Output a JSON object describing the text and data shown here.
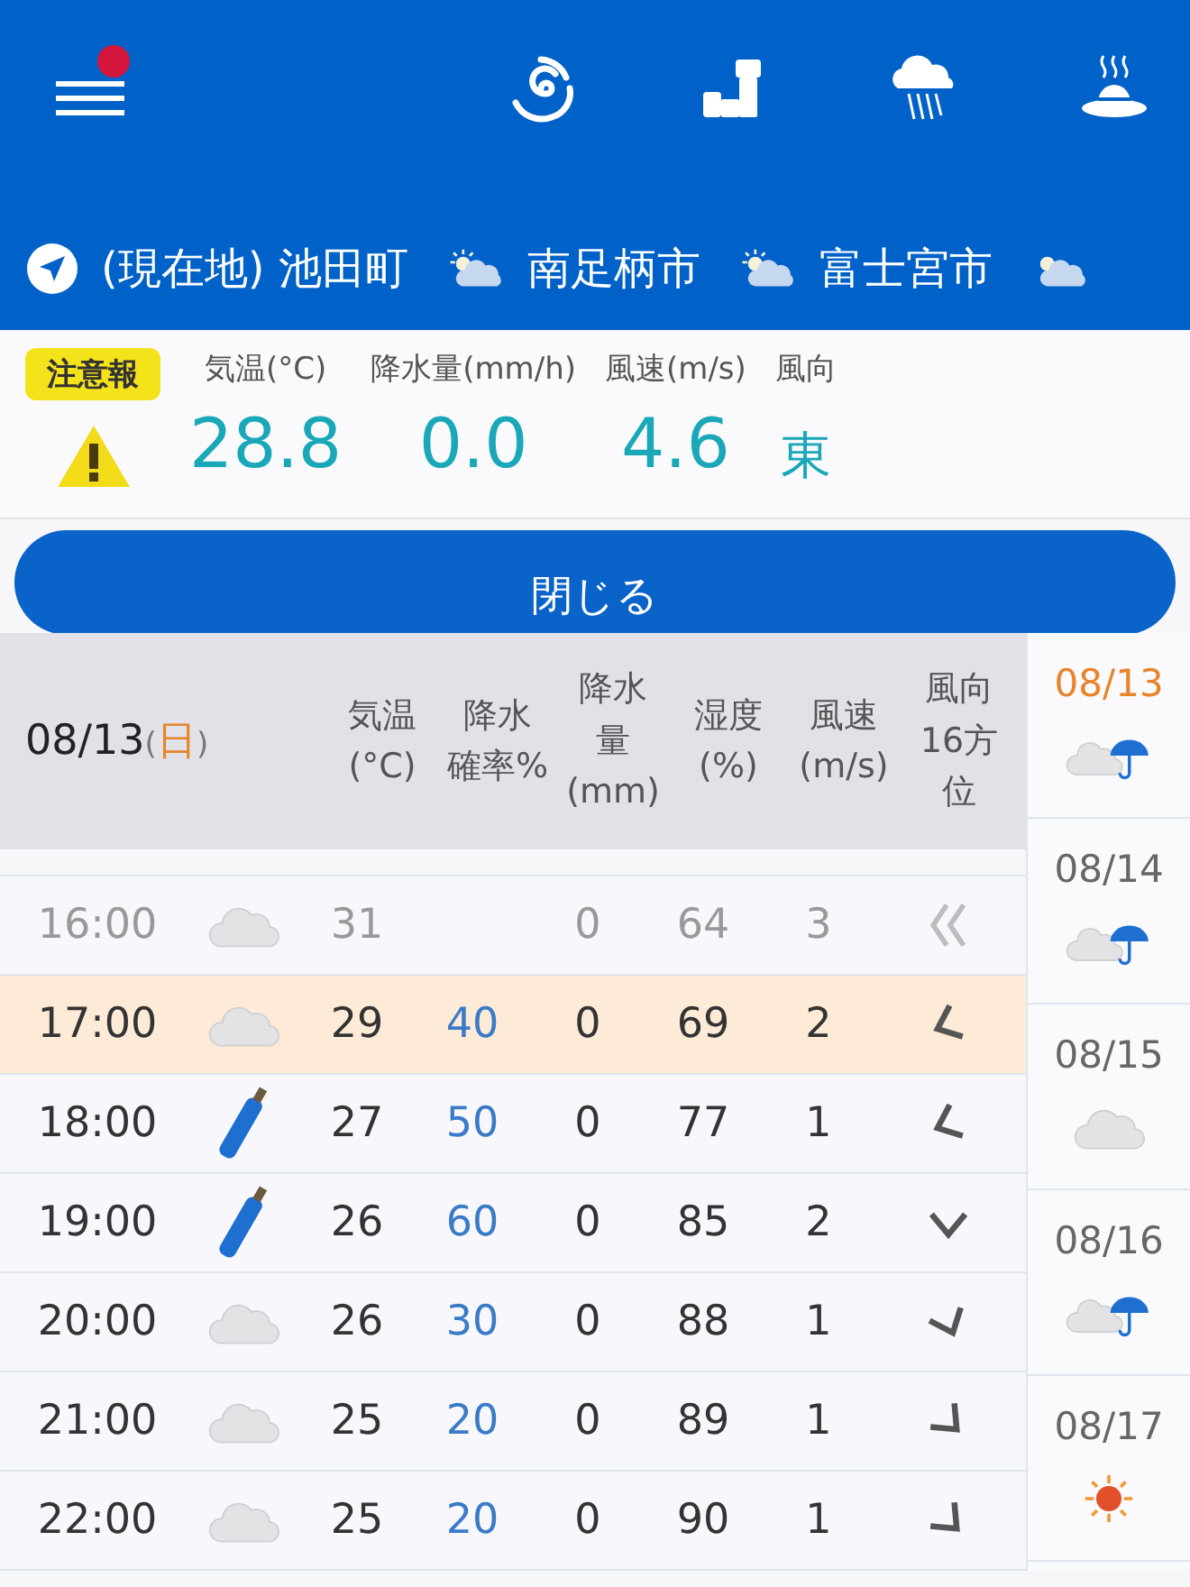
{
  "top_bar": {
    "menu_notification": true
  },
  "locations": [
    {
      "name": "(現在地) 池田町",
      "kind": "current"
    },
    {
      "name": "南足柄市",
      "kind": "weather"
    },
    {
      "name": "富士宮市",
      "kind": "weather"
    }
  ],
  "alert": {
    "badge": "注意報",
    "labels": [
      "気温(°C)",
      "降水量(mm/h)",
      "風速(m/s)",
      "風向"
    ],
    "values": [
      "28.8",
      "0.0",
      "4.6",
      "東"
    ]
  },
  "close_button": "閉じる",
  "table": {
    "date": "08/13",
    "weekday": "日",
    "brackets": [
      "(",
      ")"
    ],
    "columns": [
      [
        "気温",
        "(°C)"
      ],
      [
        "降水",
        "確率%"
      ],
      [
        "降水",
        "量",
        "(mm)"
      ],
      [
        "湿度",
        "(%)"
      ],
      [
        "風速",
        "(m/s)"
      ],
      [
        "風向",
        "16方",
        "位"
      ]
    ],
    "rows": [
      {
        "time": "16:00",
        "weather": {
          "kind": "cloudy"
        },
        "temp": "31",
        "precip": "0",
        "humidity": "64",
        "wind": "3",
        "wind_arrow": {
          "kind": "double"
        },
        "past": true,
        "selected": false
      },
      {
        "time": "17:00",
        "weather": {
          "kind": "cloudy"
        },
        "temp": "29",
        "rain_chance": "40",
        "precip": "0",
        "humidity": "69",
        "wind": "2",
        "wind_arrow": {
          "kind": "WSW"
        },
        "past": false,
        "selected": true
      },
      {
        "time": "18:00",
        "weather": {
          "kind": "umbrella"
        },
        "temp": "27",
        "rain_chance": "50",
        "precip": "0",
        "humidity": "77",
        "wind": "1",
        "wind_arrow": {
          "kind": "WSW"
        },
        "past": false,
        "selected": false
      },
      {
        "time": "19:00",
        "weather": {
          "kind": "umbrella"
        },
        "temp": "26",
        "rain_chance": "60",
        "precip": "0",
        "humidity": "85",
        "wind": "2",
        "wind_arrow": {
          "kind": "S"
        },
        "past": false,
        "selected": false
      },
      {
        "time": "20:00",
        "weather": {
          "kind": "cloudy"
        },
        "temp": "26",
        "rain_chance": "30",
        "precip": "0",
        "humidity": "88",
        "wind": "1",
        "wind_arrow": {
          "kind": "SSE"
        },
        "past": false,
        "selected": false
      },
      {
        "time": "21:00",
        "weather": {
          "kind": "cloudy"
        },
        "temp": "25",
        "rain_chance": "20",
        "precip": "0",
        "humidity": "89",
        "wind": "1",
        "wind_arrow": {
          "kind": "SE"
        },
        "past": false,
        "selected": false
      },
      {
        "time": "22:00",
        "weather": {
          "kind": "cloudy"
        },
        "temp": "25",
        "rain_chance": "20",
        "precip": "0",
        "humidity": "90",
        "wind": "1",
        "wind_arrow": {
          "kind": "SE"
        },
        "past": false,
        "selected": false
      }
    ]
  },
  "days": [
    {
      "date": "08/13",
      "weather": {
        "kind": "cloud_rain"
      },
      "selected": true
    },
    {
      "date": "08/14",
      "weather": {
        "kind": "cloud_rain"
      },
      "selected": false
    },
    {
      "date": "08/15",
      "weather": {
        "kind": "cloudy"
      },
      "selected": false
    },
    {
      "date": "08/16",
      "weather": {
        "kind": "cloud_rain"
      },
      "selected": false
    },
    {
      "date": "08/17",
      "weather": {
        "kind": "sunny"
      },
      "selected": false
    }
  ]
}
